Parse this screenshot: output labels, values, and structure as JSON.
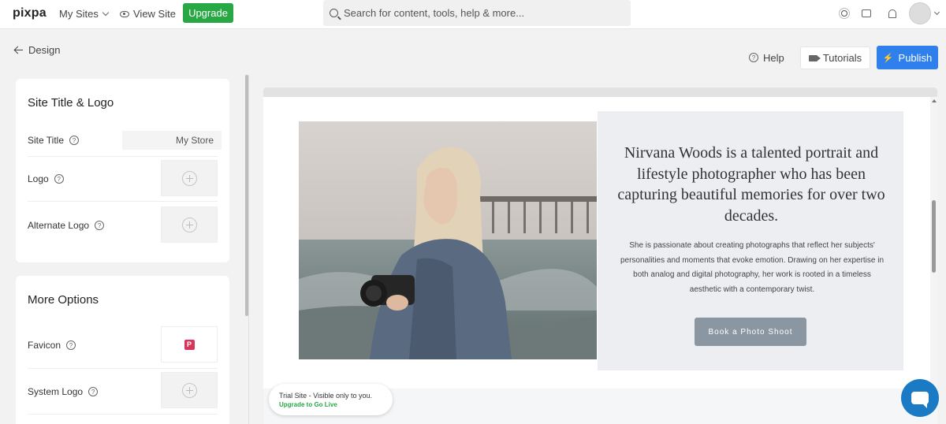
{
  "topbar": {
    "logo": "pixpa",
    "my_sites": "My Sites",
    "view_site": "View Site",
    "upgrade": "Upgrade",
    "search_placeholder": "Search for content, tools, help & more..."
  },
  "nav": {
    "back": "Design",
    "help": "Help",
    "tutorials": "Tutorials",
    "publish": "Publish"
  },
  "panel_title_logo": {
    "title": "Site Title & Logo",
    "site_title_label": "Site Title",
    "site_title_value": "My Store",
    "logo_label": "Logo",
    "alt_logo_label": "Alternate Logo"
  },
  "panel_more": {
    "title": "More Options",
    "favicon_label": "Favicon",
    "favicon_letter": "P",
    "system_logo_label": "System Logo"
  },
  "preview": {
    "headline": "Nirvana Woods is a talented portrait and lifestyle photographer who has been capturing beautiful memories for over two decades.",
    "body": "She is passionate about creating photographs that reflect her subjects' personalities and moments that evoke emotion. Drawing on her expertise in both analog and digital photography, her work is rooted in a timeless aesthetic with a contemporary twist.",
    "button": "Book a Photo Shoot"
  },
  "trial": {
    "line1": "Trial Site - Visible only to you.",
    "line2": "Upgrade to Go Live"
  },
  "colors": {
    "brand_green": "#27a845",
    "publish_blue": "#2f80ed",
    "chat_blue": "#1a7bc4",
    "cta_gray": "#8a96a2"
  }
}
